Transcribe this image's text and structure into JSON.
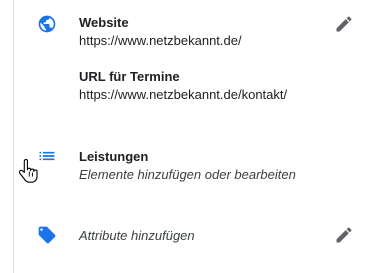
{
  "website": {
    "label": "Website",
    "value": "https://www.netzbekannt.de/",
    "icon": "globe-icon",
    "edit_icon": "pencil-icon"
  },
  "appointments": {
    "label": "URL für Termine",
    "value": "https://www.netzbekannt.de/kontakt/"
  },
  "services": {
    "label": "Leistungen",
    "value": "Elemente hinzufügen oder bearbeiten",
    "icon": "list-icon"
  },
  "attributes": {
    "value": "Attribute hinzufügen",
    "icon": "tag-icon",
    "edit_icon": "pencil-icon"
  },
  "colors": {
    "accent": "#1a73e8",
    "text": "#202124",
    "icon_grey": "#5f6368"
  }
}
